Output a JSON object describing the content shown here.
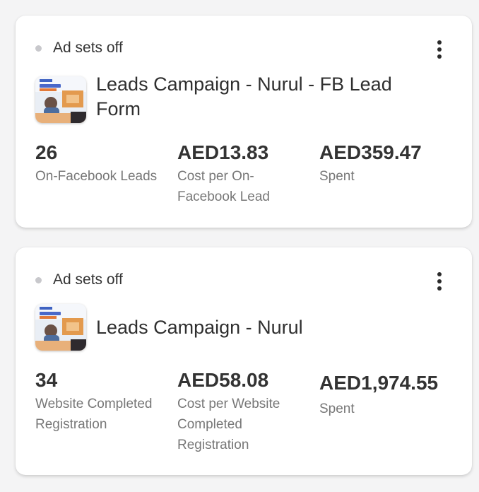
{
  "campaigns": [
    {
      "status": "Ad sets off",
      "name": "Leads Campaign - Nurul - FB Lead Form",
      "metrics": [
        {
          "value": "26",
          "label": "On-Facebook Leads"
        },
        {
          "value": "AED13.83",
          "label": "Cost per On-Facebook Lead"
        },
        {
          "value": "AED359.47",
          "label": "Spent"
        }
      ]
    },
    {
      "status": "Ad sets off",
      "name": "Leads Campaign - Nurul",
      "metrics": [
        {
          "value": "34",
          "label": "Website Completed Registration"
        },
        {
          "value": "AED58.08",
          "label": "Cost per Website Completed Registration"
        },
        {
          "value": "AED1,974.55",
          "label": "Spent"
        }
      ]
    }
  ],
  "colors": {
    "status_dot": "#c8c8cc",
    "text_primary": "#2f2f2f",
    "text_secondary": "#777777",
    "card_bg": "#ffffff",
    "page_bg": "#f4f4f5"
  },
  "icons": {
    "status": "status-dot-icon",
    "menu": "more-vertical-icon",
    "thumbnail": "ad-creative-thumbnail"
  }
}
